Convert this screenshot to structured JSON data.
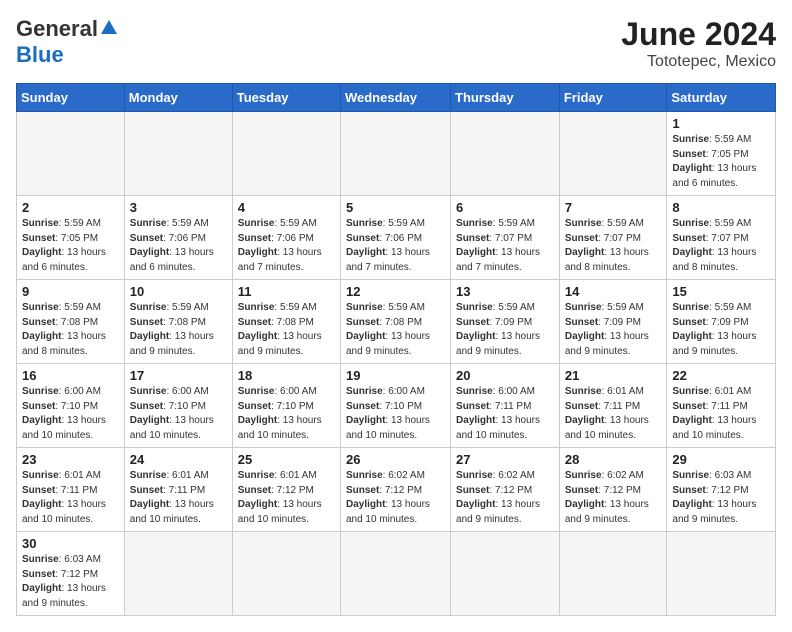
{
  "header": {
    "logo_general": "General",
    "logo_blue": "Blue",
    "title": "June 2024",
    "location": "Tototepec, Mexico"
  },
  "weekdays": [
    "Sunday",
    "Monday",
    "Tuesday",
    "Wednesday",
    "Thursday",
    "Friday",
    "Saturday"
  ],
  "weeks": [
    [
      {
        "day": "",
        "info": ""
      },
      {
        "day": "",
        "info": ""
      },
      {
        "day": "",
        "info": ""
      },
      {
        "day": "",
        "info": ""
      },
      {
        "day": "",
        "info": ""
      },
      {
        "day": "",
        "info": ""
      },
      {
        "day": "1",
        "info": "Sunrise: 5:59 AM\nSunset: 7:05 PM\nDaylight: 13 hours and 6 minutes."
      }
    ],
    [
      {
        "day": "2",
        "info": "Sunrise: 5:59 AM\nSunset: 7:05 PM\nDaylight: 13 hours and 6 minutes."
      },
      {
        "day": "3",
        "info": "Sunrise: 5:59 AM\nSunset: 7:06 PM\nDaylight: 13 hours and 6 minutes."
      },
      {
        "day": "4",
        "info": "Sunrise: 5:59 AM\nSunset: 7:06 PM\nDaylight: 13 hours and 7 minutes."
      },
      {
        "day": "5",
        "info": "Sunrise: 5:59 AM\nSunset: 7:06 PM\nDaylight: 13 hours and 7 minutes."
      },
      {
        "day": "6",
        "info": "Sunrise: 5:59 AM\nSunset: 7:07 PM\nDaylight: 13 hours and 7 minutes."
      },
      {
        "day": "7",
        "info": "Sunrise: 5:59 AM\nSunset: 7:07 PM\nDaylight: 13 hours and 8 minutes."
      },
      {
        "day": "8",
        "info": "Sunrise: 5:59 AM\nSunset: 7:07 PM\nDaylight: 13 hours and 8 minutes."
      }
    ],
    [
      {
        "day": "9",
        "info": "Sunrise: 5:59 AM\nSunset: 7:08 PM\nDaylight: 13 hours and 8 minutes."
      },
      {
        "day": "10",
        "info": "Sunrise: 5:59 AM\nSunset: 7:08 PM\nDaylight: 13 hours and 9 minutes."
      },
      {
        "day": "11",
        "info": "Sunrise: 5:59 AM\nSunset: 7:08 PM\nDaylight: 13 hours and 9 minutes."
      },
      {
        "day": "12",
        "info": "Sunrise: 5:59 AM\nSunset: 7:08 PM\nDaylight: 13 hours and 9 minutes."
      },
      {
        "day": "13",
        "info": "Sunrise: 5:59 AM\nSunset: 7:09 PM\nDaylight: 13 hours and 9 minutes."
      },
      {
        "day": "14",
        "info": "Sunrise: 5:59 AM\nSunset: 7:09 PM\nDaylight: 13 hours and 9 minutes."
      },
      {
        "day": "15",
        "info": "Sunrise: 5:59 AM\nSunset: 7:09 PM\nDaylight: 13 hours and 9 minutes."
      }
    ],
    [
      {
        "day": "16",
        "info": "Sunrise: 6:00 AM\nSunset: 7:10 PM\nDaylight: 13 hours and 10 minutes."
      },
      {
        "day": "17",
        "info": "Sunrise: 6:00 AM\nSunset: 7:10 PM\nDaylight: 13 hours and 10 minutes."
      },
      {
        "day": "18",
        "info": "Sunrise: 6:00 AM\nSunset: 7:10 PM\nDaylight: 13 hours and 10 minutes."
      },
      {
        "day": "19",
        "info": "Sunrise: 6:00 AM\nSunset: 7:10 PM\nDaylight: 13 hours and 10 minutes."
      },
      {
        "day": "20",
        "info": "Sunrise: 6:00 AM\nSunset: 7:11 PM\nDaylight: 13 hours and 10 minutes."
      },
      {
        "day": "21",
        "info": "Sunrise: 6:01 AM\nSunset: 7:11 PM\nDaylight: 13 hours and 10 minutes."
      },
      {
        "day": "22",
        "info": "Sunrise: 6:01 AM\nSunset: 7:11 PM\nDaylight: 13 hours and 10 minutes."
      }
    ],
    [
      {
        "day": "23",
        "info": "Sunrise: 6:01 AM\nSunset: 7:11 PM\nDaylight: 13 hours and 10 minutes."
      },
      {
        "day": "24",
        "info": "Sunrise: 6:01 AM\nSunset: 7:11 PM\nDaylight: 13 hours and 10 minutes."
      },
      {
        "day": "25",
        "info": "Sunrise: 6:01 AM\nSunset: 7:12 PM\nDaylight: 13 hours and 10 minutes."
      },
      {
        "day": "26",
        "info": "Sunrise: 6:02 AM\nSunset: 7:12 PM\nDaylight: 13 hours and 10 minutes."
      },
      {
        "day": "27",
        "info": "Sunrise: 6:02 AM\nSunset: 7:12 PM\nDaylight: 13 hours and 9 minutes."
      },
      {
        "day": "28",
        "info": "Sunrise: 6:02 AM\nSunset: 7:12 PM\nDaylight: 13 hours and 9 minutes."
      },
      {
        "day": "29",
        "info": "Sunrise: 6:03 AM\nSunset: 7:12 PM\nDaylight: 13 hours and 9 minutes."
      }
    ],
    [
      {
        "day": "30",
        "info": "Sunrise: 6:03 AM\nSunset: 7:12 PM\nDaylight: 13 hours and 9 minutes."
      },
      {
        "day": "",
        "info": ""
      },
      {
        "day": "",
        "info": ""
      },
      {
        "day": "",
        "info": ""
      },
      {
        "day": "",
        "info": ""
      },
      {
        "day": "",
        "info": ""
      },
      {
        "day": "",
        "info": ""
      }
    ]
  ]
}
